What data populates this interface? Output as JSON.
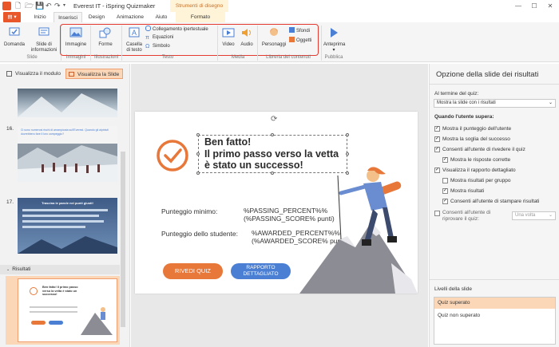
{
  "window": {
    "title": "Everest IT - iSpring Quizmaker",
    "context_tab_header": "Strumenti di disegno",
    "minimize": "—",
    "maximize": "☐",
    "close": "✕"
  },
  "tabs": {
    "file": "▤ ▾",
    "home": "Inizio",
    "insert": "Inserisci",
    "design": "Design",
    "animation": "Animazione",
    "help": "Aiuto",
    "format": "Formato"
  },
  "ribbon": {
    "question": "Domanda",
    "info_slide": "Slide di informazioni",
    "image": "Immagine",
    "shapes": "Forme",
    "textbox": "Casella di testo",
    "hyperlink": "Collegamento ipertestuale",
    "equations": "Equazioni",
    "symbol": "Simbolo",
    "video": "Video",
    "audio": "Audio",
    "characters": "Personaggi",
    "backgrounds": "Sfondi",
    "objects": "Oggetti",
    "preview": "Anteprima",
    "groups": {
      "slide": "Slide",
      "images": "Immagini",
      "illustrations": "Illustrazioni",
      "text": "Testo",
      "media": "Media",
      "library": "Libreria dei contenuti",
      "publish": "Pubblica"
    }
  },
  "left_panel": {
    "view_form": "Visualizza il modulo",
    "view_slide": "Visualizza la Slide",
    "slide16": {
      "num": "16.",
      "text": "Ci sono numerosi rischi di arrampicata sull'Everest. Quando gli alpinisti dovrebbero fare il loro campeggio?"
    },
    "slide17": {
      "num": "17.",
      "title": "Trascina le parole nei punti giusti!"
    },
    "results_section": "Risultati",
    "result_thumb": {
      "title": "Ben fatto! Il primo passo verso la vetta è stato un successo!"
    }
  },
  "slide": {
    "title": "Ben fatto!\nIl primo passo verso la vetta\nè stato un successo!",
    "min_score_label": "Punteggio minimo:",
    "min_score_value": "%PASSING_PERCENT%%\n(%PASSING_SCORE% punti)",
    "student_score_label": "Punteggio dello studente:",
    "student_score_value": "%AWARDED_PERCENT%%\n(%AWARDED_SCORE% punti)",
    "review_button": "RIVEDI QUIZ",
    "report_button": "RAPPORTO\nDETTAGLIATO",
    "colors": {
      "accent": "#e8773a",
      "blue": "#4a7fd4"
    }
  },
  "right_panel": {
    "heading": "Opzione della slide dei risultati",
    "end_label": "Al termine del quiz:",
    "end_value": "Mostra la slide con i risultati",
    "passed_heading": "Quando l'utente supera:",
    "options": [
      {
        "label": "Mostra il punteggio dell'utente",
        "checked": true
      },
      {
        "label": "Mostra la soglia del successo",
        "checked": true
      },
      {
        "label": "Consenti all'utente di rivedere il quiz",
        "checked": true
      },
      {
        "label": "Mostra le risposte corrette",
        "checked": true
      },
      {
        "label": "Visualizza il rapporto dettagliato",
        "checked": true
      },
      {
        "label": "Mostra risultati per gruppo",
        "checked": false
      },
      {
        "label": "Mostra risultati",
        "checked": true
      },
      {
        "label": "Consenti all'utente di stampare risultati",
        "checked": true
      },
      {
        "label": "Consenti all'utente di riprovare il quiz:",
        "checked": false
      }
    ],
    "retry_value": "Una volta",
    "levels_heading": "Livelli della slide",
    "levels": [
      "Quiz superato",
      "Quiz non superato"
    ]
  }
}
